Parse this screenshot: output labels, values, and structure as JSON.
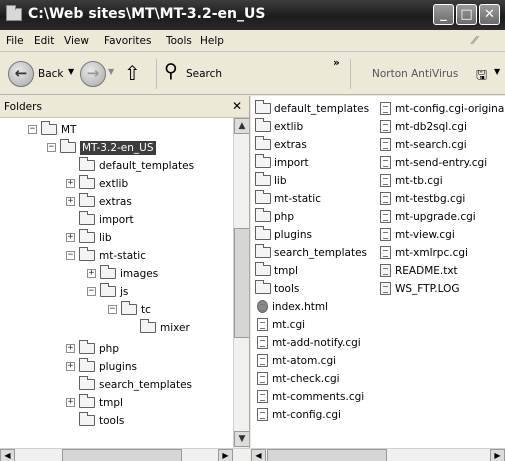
{
  "window": {
    "title": "C:\\Web sites\\MT\\MT-3.2-en_US",
    "minimize": "_",
    "maximize": "□",
    "close": "✕"
  },
  "menu": [
    "File",
    "Edit",
    "View",
    "Favorites",
    "Tools",
    "Help"
  ],
  "toolbar": {
    "back": "Back",
    "search": "Search",
    "overflow": "»",
    "norton": "Norton AntiVirus"
  },
  "folders_pane": {
    "title": "Folders",
    "close": "✕",
    "tree": [
      {
        "label": "MT",
        "level": 1,
        "expander": "−"
      },
      {
        "label": "MT-3.2-en_US",
        "level": 2,
        "expander": "−",
        "selected": true
      },
      {
        "label": "default_templates",
        "level": 3,
        "expander": ""
      },
      {
        "label": "extlib",
        "level": 3,
        "expander": "+"
      },
      {
        "label": "extras",
        "level": 3,
        "expander": "+"
      },
      {
        "label": "import",
        "level": 3,
        "expander": ""
      },
      {
        "label": "lib",
        "level": 3,
        "expander": "+"
      },
      {
        "label": "mt-static",
        "level": 3,
        "expander": "−"
      },
      {
        "label": "images",
        "level": 4,
        "expander": "+"
      },
      {
        "label": "js",
        "level": 4,
        "expander": "−"
      },
      {
        "label": "tc",
        "level": 5,
        "expander": "−"
      },
      {
        "label": "mixer",
        "level": 6,
        "expander": ""
      },
      {
        "label": "php",
        "level": 3,
        "expander": "+"
      },
      {
        "label": "plugins",
        "level": 3,
        "expander": "+"
      },
      {
        "label": "search_templates",
        "level": 3,
        "expander": ""
      },
      {
        "label": "tmpl",
        "level": 3,
        "expander": "+"
      },
      {
        "label": "tools",
        "level": 3,
        "expander": ""
      }
    ]
  },
  "files_col1": [
    {
      "name": "default_templates",
      "type": "folder"
    },
    {
      "name": "extlib",
      "type": "folder"
    },
    {
      "name": "extras",
      "type": "folder"
    },
    {
      "name": "import",
      "type": "folder"
    },
    {
      "name": "lib",
      "type": "folder"
    },
    {
      "name": "mt-static",
      "type": "folder"
    },
    {
      "name": "php",
      "type": "folder"
    },
    {
      "name": "plugins",
      "type": "folder"
    },
    {
      "name": "search_templates",
      "type": "folder"
    },
    {
      "name": "tmpl",
      "type": "folder"
    },
    {
      "name": "tools",
      "type": "folder"
    },
    {
      "name": "index.html",
      "type": "html"
    },
    {
      "name": "mt.cgi",
      "type": "file"
    },
    {
      "name": "mt-add-notify.cgi",
      "type": "file"
    },
    {
      "name": "mt-atom.cgi",
      "type": "file"
    },
    {
      "name": "mt-check.cgi",
      "type": "file"
    },
    {
      "name": "mt-comments.cgi",
      "type": "file"
    },
    {
      "name": "mt-config.cgi",
      "type": "file"
    }
  ],
  "files_col2": [
    {
      "name": "mt-config.cgi-original",
      "type": "file"
    },
    {
      "name": "mt-db2sql.cgi",
      "type": "file"
    },
    {
      "name": "mt-search.cgi",
      "type": "file"
    },
    {
      "name": "mt-send-entry.cgi",
      "type": "file"
    },
    {
      "name": "mt-tb.cgi",
      "type": "file"
    },
    {
      "name": "mt-testbg.cgi",
      "type": "file"
    },
    {
      "name": "mt-upgrade.cgi",
      "type": "file"
    },
    {
      "name": "mt-view.cgi",
      "type": "file"
    },
    {
      "name": "mt-xmlrpc.cgi",
      "type": "file"
    },
    {
      "name": "README.txt",
      "type": "text"
    },
    {
      "name": "WS_FTP.LOG",
      "type": "text"
    }
  ]
}
